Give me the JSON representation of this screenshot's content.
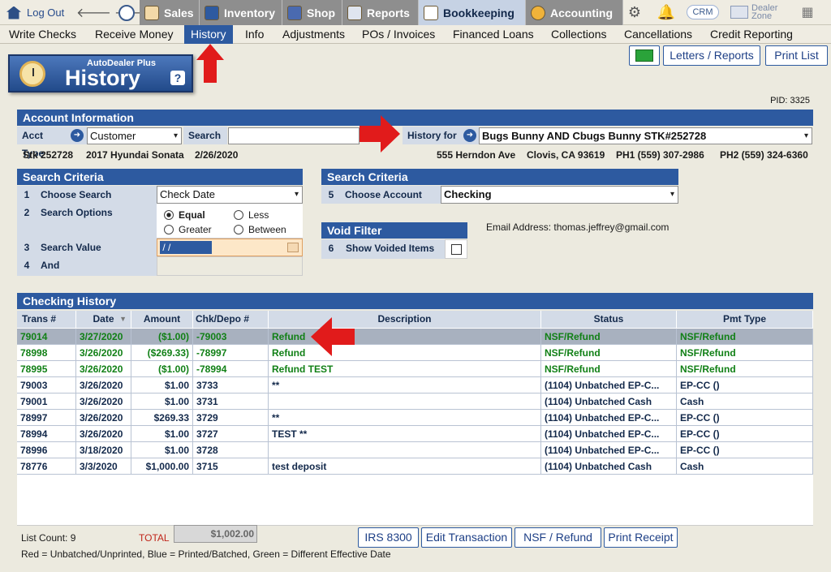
{
  "topnav": {
    "logout": "Log Out",
    "tabs": [
      {
        "label": "Sales",
        "active": false
      },
      {
        "label": "Inventory",
        "active": false
      },
      {
        "label": "Shop",
        "active": false
      },
      {
        "label": "Reports",
        "active": false
      },
      {
        "label": "Bookkeeping",
        "active": true
      },
      {
        "label": "Accounting",
        "active": false
      }
    ],
    "crm": "CRM",
    "dealer_zone": [
      "Dealer",
      "Zone"
    ]
  },
  "subnav": {
    "items": [
      "Write Checks",
      "Receive Money",
      "History",
      "Info",
      "Adjustments",
      "POs / Invoices",
      "Financed Loans",
      "Collections",
      "Cancellations",
      "Credit Reporting"
    ],
    "active": "History"
  },
  "header": {
    "brand": "AutoDealer Plus",
    "title": "History",
    "help": "?"
  },
  "buttons": {
    "letters_reports": "Letters / Reports",
    "print_list": "Print List"
  },
  "pid": "PID: 3325",
  "account": {
    "title": "Account Information",
    "acct_type_label": "Acct Type",
    "acct_type_value": "Customer",
    "search_label": "Search",
    "search_value": "",
    "history_for_label": "History for",
    "history_for_value": "Bugs Bunny AND Cbugs Bunny STK#252728",
    "stk": "Stk 252728",
    "vehicle": "2017 Hyundai Sonata",
    "date": "2/26/2020",
    "address": "555 Herndon Ave",
    "city": "Clovis, CA 93619",
    "ph1": "PH1 (559) 307-2986",
    "ph2": "PH2 (559) 324-6360"
  },
  "search_criteria_left": {
    "title": "Search Criteria",
    "rows": [
      {
        "num": "1",
        "label": "Choose Search",
        "value": "Check Date"
      },
      {
        "num": "2",
        "label": "Search Options"
      },
      {
        "num": "3",
        "label": "Search Value",
        "value": " / / "
      },
      {
        "num": "4",
        "label": "And",
        "value": ""
      }
    ],
    "options": [
      "Equal",
      "Less",
      "Greater",
      "Between"
    ],
    "selected_option": "Equal"
  },
  "search_criteria_right": {
    "title": "Search Criteria",
    "num": "5",
    "label": "Choose Account",
    "value": "Checking"
  },
  "void_filter": {
    "title": "Void Filter",
    "num": "6",
    "label": "Show Voided Items",
    "checked": false
  },
  "email": "Email Address: thomas.jeffrey@gmail.com",
  "history": {
    "title": "Checking History",
    "columns": [
      "Trans #",
      "Date",
      "Amount",
      "Chk/Depo #",
      "Description",
      "Status",
      "Pmt Type"
    ],
    "rows": [
      {
        "trans": "79014",
        "date": "3/27/2020",
        "amount": "($1.00)",
        "chk": "-79003",
        "desc": "Refund",
        "status": "NSF/Refund",
        "pmt": "NSF/Refund",
        "color": "green",
        "selected": true
      },
      {
        "trans": "78998",
        "date": "3/26/2020",
        "amount": "($269.33)",
        "chk": "-78997",
        "desc": "Refund",
        "status": "NSF/Refund",
        "pmt": "NSF/Refund",
        "color": "green",
        "selected": false
      },
      {
        "trans": "78995",
        "date": "3/26/2020",
        "amount": "($1.00)",
        "chk": "-78994",
        "desc": "Refund TEST",
        "status": "NSF/Refund",
        "pmt": "NSF/Refund",
        "color": "green",
        "selected": false
      },
      {
        "trans": "79003",
        "date": "3/26/2020",
        "amount": "$1.00",
        "chk": "3733",
        "desc": " **",
        "status": "(1104) Unbatched EP-C...",
        "pmt": "EP-CC ()",
        "color": "blue",
        "selected": false
      },
      {
        "trans": "79001",
        "date": "3/26/2020",
        "amount": "$1.00",
        "chk": "3731",
        "desc": "",
        "status": "(1104) Unbatched Cash",
        "pmt": "Cash",
        "color": "blue",
        "selected": false
      },
      {
        "trans": "78997",
        "date": "3/26/2020",
        "amount": "$269.33",
        "chk": "3729",
        "desc": " **",
        "status": "(1104) Unbatched EP-C...",
        "pmt": "EP-CC ()",
        "color": "blue",
        "selected": false
      },
      {
        "trans": "78994",
        "date": "3/26/2020",
        "amount": "$1.00",
        "chk": "3727",
        "desc": "TEST **",
        "status": "(1104) Unbatched EP-C...",
        "pmt": "EP-CC ()",
        "color": "blue",
        "selected": false
      },
      {
        "trans": "78996",
        "date": "3/18/2020",
        "amount": "$1.00",
        "chk": "3728",
        "desc": "",
        "status": "(1104) Unbatched EP-C...",
        "pmt": "EP-CC ()",
        "color": "blue",
        "selected": false
      },
      {
        "trans": "78776",
        "date": "3/3/2020",
        "amount": "$1,000.00",
        "chk": "3715",
        "desc": "test deposit",
        "status": "(1104) Unbatched Cash",
        "pmt": "Cash",
        "color": "blue",
        "selected": false
      }
    ]
  },
  "footer": {
    "list_count": "List Count: 9",
    "total_label": "TOTAL",
    "total_value": "$1,002.00",
    "legend": "Red = Unbatched/Unprinted, Blue = Printed/Batched, Green = Different Effective Date",
    "buttons": [
      "IRS 8300",
      "Edit Transaction",
      "NSF / Refund",
      "Print Receipt"
    ]
  },
  "colors": {
    "accent": "#2d5aa0",
    "green_text": "#118016",
    "blue_text": "#13294b",
    "arrow": "#e11b1b"
  }
}
